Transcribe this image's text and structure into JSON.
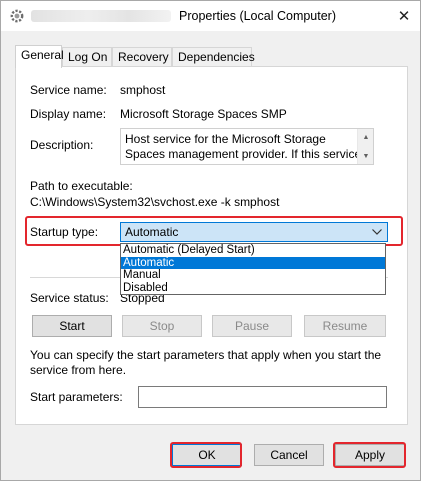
{
  "window": {
    "title": "Properties (Local Computer)",
    "close_glyph": "✕"
  },
  "tabs": [
    {
      "label": "General",
      "active": true
    },
    {
      "label": "Log On",
      "active": false
    },
    {
      "label": "Recovery",
      "active": false
    },
    {
      "label": "Dependencies",
      "active": false
    }
  ],
  "general": {
    "service_name_label": "Service name:",
    "service_name_value": "smphost",
    "display_name_label": "Display name:",
    "display_name_value": "Microsoft Storage Spaces SMP",
    "description_label": "Description:",
    "description_value": "Host service for the Microsoft Storage Spaces management provider. If this service is stopped or",
    "path_label": "Path to executable:",
    "path_value": "C:\\Windows\\System32\\svchost.exe -k smphost",
    "startup_type_label": "Startup type:",
    "startup_type_value": "Automatic",
    "startup_options": [
      {
        "label": "Automatic (Delayed Start)",
        "selected": false
      },
      {
        "label": "Automatic",
        "selected": true
      },
      {
        "label": "Manual",
        "selected": false
      },
      {
        "label": "Disabled",
        "selected": false
      }
    ],
    "service_status_label": "Service status:",
    "service_status_value": "Stopped",
    "buttons": {
      "start": "Start",
      "stop": "Stop",
      "pause": "Pause",
      "resume": "Resume"
    },
    "hint_text": "You can specify the start parameters that apply when you start the service from here.",
    "start_params_label": "Start parameters:",
    "start_params_value": ""
  },
  "footer": {
    "ok": "OK",
    "cancel": "Cancel",
    "apply": "Apply"
  },
  "colors": {
    "accent": "#0078d7",
    "highlight_box": "#e3262d",
    "combo_bg": "#cce4f7"
  }
}
